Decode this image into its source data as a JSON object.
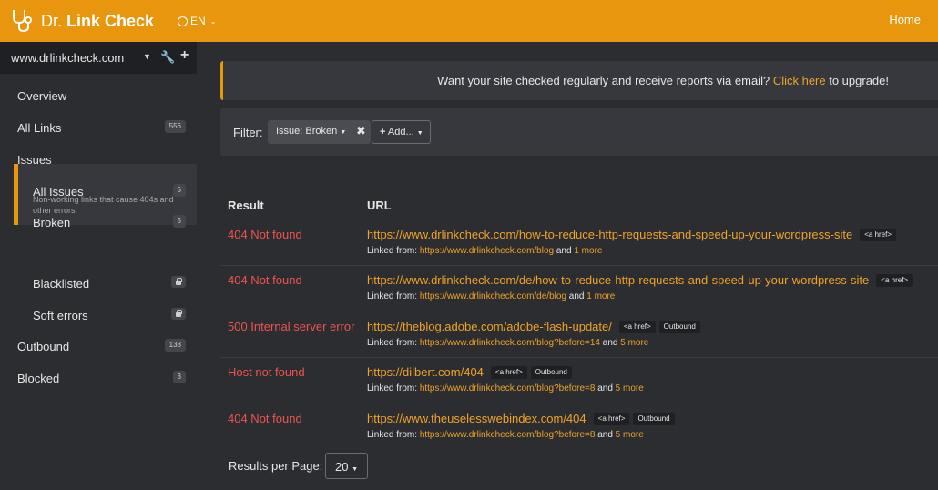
{
  "header": {
    "brand_prefix": "Dr. ",
    "brand_bold": "Link Check",
    "language": "EN",
    "home_label": "Home"
  },
  "sidebar": {
    "site": "www.drlinkcheck.com",
    "items": [
      {
        "label": "Overview"
      },
      {
        "label": "All Links",
        "badge": "556"
      },
      {
        "label": "Issues"
      },
      {
        "label": "All Issues",
        "badge": "5"
      },
      {
        "label": "Broken",
        "badge": "5",
        "description": "Non-working links that cause 404s and other errors."
      },
      {
        "label": "Blacklisted"
      },
      {
        "label": "Soft errors"
      },
      {
        "label": "Outbound",
        "badge": "138"
      },
      {
        "label": "Blocked",
        "badge": "3"
      }
    ]
  },
  "banner": {
    "text": "Want your site checked regularly and receive reports via email? ",
    "link": "Click here",
    "suffix": " to upgrade!"
  },
  "filter": {
    "label": "Filter:",
    "chip_key": "Issue:",
    "chip_value": "Broken",
    "add_label": "Add..."
  },
  "table": {
    "columns": [
      "Result",
      "URL"
    ],
    "linked_from_label": "Linked from:",
    "rows": [
      {
        "result": "404 Not found",
        "url": "https://www.drlinkcheck.com/how-to-reduce-http-requests-and-speed-up-your-wordpress-site",
        "tags": [
          "<a href>"
        ],
        "linked_url": "https://www.drlinkcheck.com/blog",
        "and": "and",
        "more": "1 more"
      },
      {
        "result": "404 Not found",
        "url": "https://www.drlinkcheck.com/de/how-to-reduce-http-requests-and-speed-up-your-wordpress-site",
        "tags": [
          "<a href>"
        ],
        "linked_url": "https://www.drlinkcheck.com/de/blog",
        "and": "and",
        "more": "1 more"
      },
      {
        "result": "500 Internal server error",
        "url": "https://theblog.adobe.com/adobe-flash-update/",
        "tags": [
          "<a href>",
          "Outbound"
        ],
        "linked_url": "https://www.drlinkcheck.com/blog?before=14",
        "and": "and",
        "more": "5 more"
      },
      {
        "result": "Host not found",
        "url": "https://dilbert.com/404",
        "tags": [
          "<a href>",
          "Outbound"
        ],
        "linked_url": "https://www.drlinkcheck.com/blog?before=8",
        "and": "and",
        "more": "5 more"
      },
      {
        "result": "404 Not found",
        "url": "https://www.theuselesswebindex.com/404",
        "tags": [
          "<a href>",
          "Outbound"
        ],
        "linked_url": "https://www.drlinkcheck.com/blog?before=8",
        "and": "and",
        "more": "5 more"
      }
    ]
  },
  "pagination": {
    "label": "Results per Page:",
    "value": "20"
  },
  "colors": {
    "accent": "#e8960e",
    "error": "#ef5350",
    "link": "#f0a227",
    "background": "#2b2d31"
  }
}
